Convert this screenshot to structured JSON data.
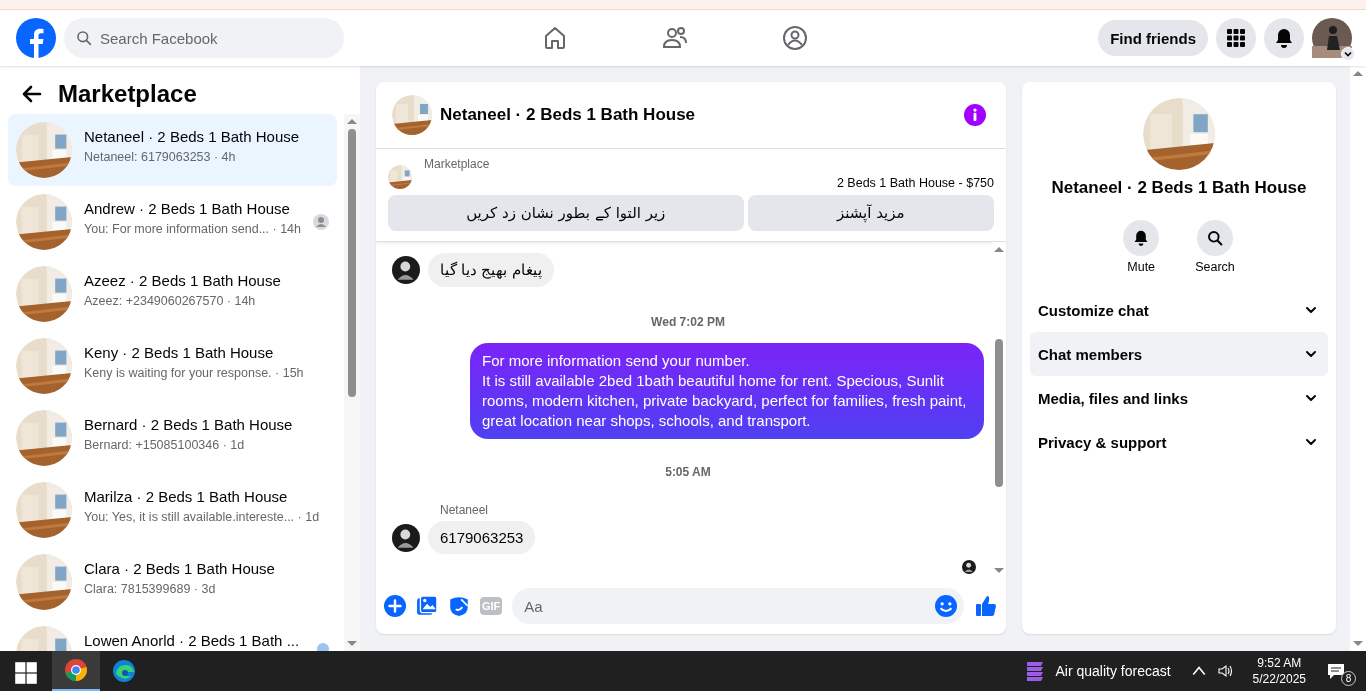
{
  "top_nav": {
    "search_placeholder": "Search Facebook",
    "find_friends": "Find friends"
  },
  "sidebar": {
    "title": "Marketplace",
    "conversations": [
      {
        "title": "Netaneel · 2 Beds 1 Bath House",
        "preview": "Netaneel: 6179063253 · 4h",
        "selected": true,
        "seen": false,
        "unread": false
      },
      {
        "title": "Andrew · 2 Beds 1 Bath House",
        "preview": "You: For more information send... · 14h",
        "selected": false,
        "seen": true,
        "unread": false
      },
      {
        "title": "Azeez · 2 Beds 1 Bath House",
        "preview": "Azeez: +2349060267570 · 14h",
        "selected": false,
        "seen": false,
        "unread": false
      },
      {
        "title": "Keny · 2 Beds 1 Bath House",
        "preview": "Keny is waiting for your response. · 15h",
        "selected": false,
        "seen": false,
        "unread": false
      },
      {
        "title": "Bernard · 2 Beds 1 Bath House",
        "preview": "Bernard: +15085100346 · 1d",
        "selected": false,
        "seen": false,
        "unread": false
      },
      {
        "title": "Marilza · 2 Beds 1 Bath House",
        "preview": "You: Yes, it is still available.intereste... · 1d",
        "selected": false,
        "seen": false,
        "unread": false
      },
      {
        "title": "Clara · 2 Beds 1 Bath House",
        "preview": "Clara: 7815399689 · 3d",
        "selected": false,
        "seen": false,
        "unread": false
      },
      {
        "title": "Lowen Anorld · 2 Beds 1 Bath ...",
        "selected": false,
        "seen": false,
        "unread": true
      }
    ]
  },
  "chat": {
    "title": "Netaneel · 2 Beds 1 Bath House",
    "listing": {
      "label": "Marketplace",
      "title": "2 Beds 1 Bath House - $750"
    },
    "actions": [
      "مزید آپشنز",
      "زیر التوا کے بطور نشان زد کریں"
    ],
    "messages": [
      {
        "kind": "received",
        "text": "پیغام بھیج دیا گیا"
      },
      {
        "kind": "timestamp",
        "text": "Wed 7:02 PM"
      },
      {
        "kind": "sent",
        "text": "For more information send your number.\nIt is still available 2bed 1bath beautiful home for rent. Specious, Sunlit rooms, modern kitchen, private backyard, perfect for families, fresh paint, great location near shops, schools, and transport."
      },
      {
        "kind": "timestamp",
        "text": "5:05 AM"
      },
      {
        "kind": "sender",
        "text": "Netaneel"
      },
      {
        "kind": "received",
        "text": "6179063253"
      }
    ],
    "composer": {
      "placeholder": "Aa",
      "gif_label": "GIF"
    }
  },
  "details": {
    "title": "Netaneel · 2 Beds 1 Bath House",
    "actions": [
      {
        "kind": "bell",
        "label": "Mute"
      },
      {
        "kind": "search",
        "label": "Search"
      }
    ],
    "sections": [
      {
        "label": "Customize chat",
        "selected": false
      },
      {
        "label": "Chat members",
        "selected": true
      },
      {
        "label": "Media, files and links",
        "selected": false
      },
      {
        "label": "Privacy & support",
        "selected": false
      }
    ]
  },
  "taskbar": {
    "widget": "Air quality forecast",
    "time": "9:52 AM",
    "date": "5/22/2025",
    "notifications": "8"
  }
}
